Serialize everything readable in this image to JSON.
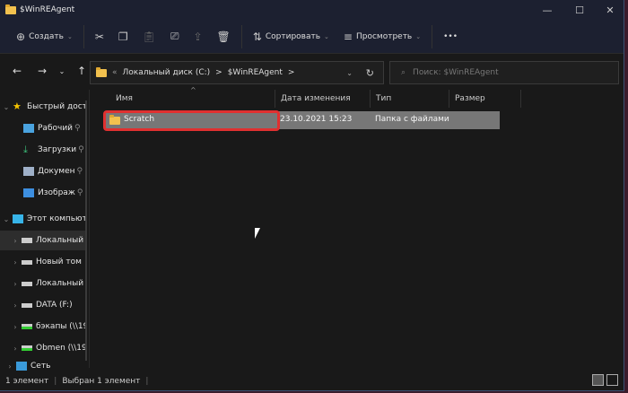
{
  "window": {
    "title": "$WinREAgent",
    "minimize": "—",
    "maximize": "☐",
    "close": "✕"
  },
  "toolbar": {
    "create": "Создать",
    "sort": "Сортировать",
    "view": "Просмотреть",
    "more": "•••"
  },
  "address": {
    "crumbs_prefix": "«",
    "drive": "Локальный диск (C:)",
    "folder": "$WinREAgent",
    "sep": ">"
  },
  "search": {
    "placeholder": "Поиск: $WinREAgent"
  },
  "sidebar": {
    "items": [
      {
        "label": "Быстрый дост"
      },
      {
        "label": "Рабочий"
      },
      {
        "label": "Загрузки"
      },
      {
        "label": "Докумен"
      },
      {
        "label": "Изображ"
      },
      {
        "label": "Этот компьют"
      },
      {
        "label": "Локальный"
      },
      {
        "label": "Новый том"
      },
      {
        "label": "Локальный"
      },
      {
        "label": "DATA (F:)"
      },
      {
        "label": "бэкапы (\\\\19"
      },
      {
        "label": "Obmen (\\\\19"
      },
      {
        "label": "Сеть"
      }
    ]
  },
  "columns": {
    "name": "Имя",
    "date": "Дата изменения",
    "type": "Тип",
    "size": "Размер"
  },
  "files": [
    {
      "name": "Scratch",
      "date": "23.10.2021 15:23",
      "type": "Папка с файлами",
      "size": ""
    }
  ],
  "status": {
    "count": "1 элемент",
    "selected": "Выбран 1 элемент"
  }
}
